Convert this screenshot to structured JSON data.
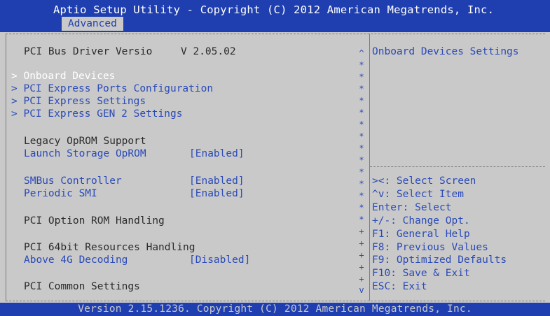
{
  "header": {
    "title": "Aptio Setup Utility - Copyright (C) 2012 American Megatrends, Inc.",
    "tab": "Advanced"
  },
  "left": {
    "version_label": "PCI Bus Driver Versio",
    "version_value": "V 2.05.02",
    "submenus": [
      "> Onboard Devices",
      "> PCI Express Ports Configuration",
      "> PCI Express Settings",
      "> PCI Express GEN 2 Settings"
    ],
    "legacy_heading": "Legacy OpROM Support",
    "launch_storage_label": "Launch Storage OpROM",
    "launch_storage_value": "[Enabled]",
    "smbus_label": "SMBus Controller",
    "smbus_value": "[Enabled]",
    "periodic_smi_label": "Periodic SMI",
    "periodic_smi_value": "[Enabled]",
    "option_rom_heading": "PCI Option ROM Handling",
    "resources_heading": "PCI 64bit Resources Handling",
    "above4g_label": "Above 4G Decoding",
    "above4g_value": "[Disabled]",
    "common_heading": "PCI Common Settings"
  },
  "scrollbar": {
    "top": "^",
    "bottom": "v",
    "star": "*",
    "plus": "+"
  },
  "right": {
    "item_help": "Onboard Devices Settings",
    "keys": [
      "><: Select Screen",
      "^v: Select Item",
      "Enter: Select",
      "+/-: Change Opt.",
      "F1: General Help",
      "F8: Previous Values",
      "F9: Optimized Defaults",
      "F10: Save & Exit",
      "ESC: Exit"
    ]
  },
  "footer": {
    "text": "Version 2.15.1236. Copyright (C) 2012 American Megatrends, Inc."
  },
  "colors": {
    "bar_blue": "#1f3fb0",
    "background": "#c9c9c9",
    "item_blue": "#2a4ab8",
    "selected": "#ffffff"
  }
}
